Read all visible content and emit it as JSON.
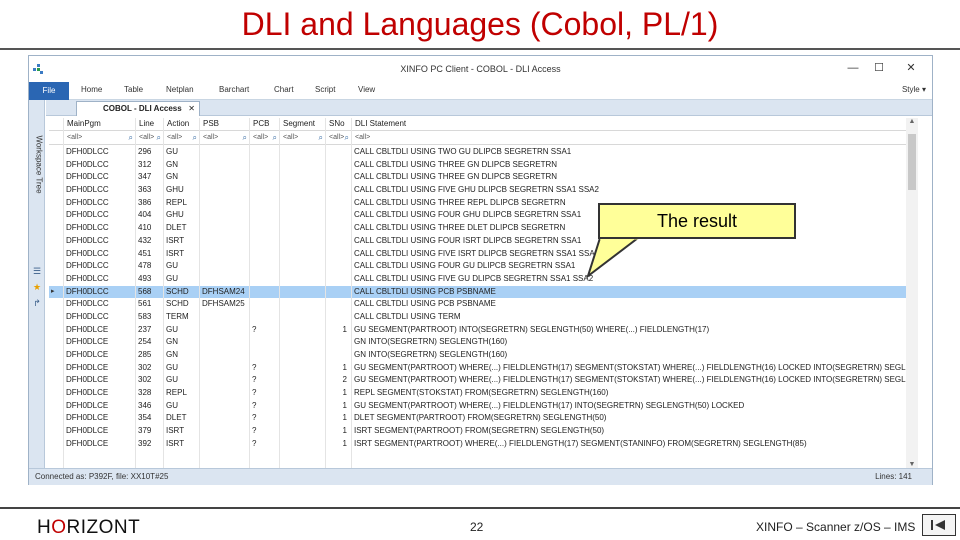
{
  "slide": {
    "title": "DLI and Languages (Cobol, PL/1)",
    "callout": "The result",
    "footer": {
      "brand_prefix": "H",
      "brand_o": "O",
      "brand_suffix": "RIZONT",
      "page_number": "22",
      "text": "XINFO – Scanner z/OS – IMS"
    }
  },
  "window": {
    "title": "XINFO PC Client - COBOL - DLI Access",
    "min": "—",
    "max": "☐",
    "close": "✕"
  },
  "ribbon": {
    "tabs": [
      "File",
      "Home",
      "Table",
      "Netplan",
      "Barchart",
      "Chart",
      "Script",
      "View"
    ],
    "style_menu": "Style"
  },
  "sidebar": {
    "workspace_tree": "Workspace Tree"
  },
  "doc_tab": {
    "label": "COBOL - DLI Access",
    "close": "✕"
  },
  "grid": {
    "columns": [
      "MainPgm",
      "Line",
      "Action",
      "PSB",
      "PCB",
      "Segment",
      "SNo",
      "DLI Statement"
    ],
    "filter_placeholder": "<all>",
    "rows": [
      [
        "DFH0DLCC",
        "296",
        "GU",
        "",
        "",
        "",
        "",
        "CALL CBLTDLI USING TWO GU DLIPCB SEGRETRN SSA1",
        false
      ],
      [
        "DFH0DLCC",
        "312",
        "GN",
        "",
        "",
        "",
        "",
        "CALL CBLTDLI USING THREE GN DLIPCB SEGRETRN",
        false
      ],
      [
        "DFH0DLCC",
        "347",
        "GN",
        "",
        "",
        "",
        "",
        "CALL CBLTDLI USING THREE GN DLIPCB SEGRETRN",
        false
      ],
      [
        "DFH0DLCC",
        "363",
        "GHU",
        "",
        "",
        "",
        "",
        "CALL CBLTDLI USING FIVE GHU DLIPCB SEGRETRN SSA1 SSA2",
        false
      ],
      [
        "DFH0DLCC",
        "386",
        "REPL",
        "",
        "",
        "",
        "",
        "CALL CBLTDLI USING THREE REPL DLIPCB SEGRETRN",
        false
      ],
      [
        "DFH0DLCC",
        "404",
        "GHU",
        "",
        "",
        "",
        "",
        "CALL CBLTDLI USING FOUR GHU DLIPCB SEGRETRN SSA1",
        false
      ],
      [
        "DFH0DLCC",
        "410",
        "DLET",
        "",
        "",
        "",
        "",
        "CALL CBLTDLI USING THREE DLET DLIPCB SEGRETRN",
        false
      ],
      [
        "DFH0DLCC",
        "432",
        "ISRT",
        "",
        "",
        "",
        "",
        "CALL CBLTDLI USING FOUR ISRT DLIPCB SEGRETRN SSA1",
        false
      ],
      [
        "DFH0DLCC",
        "451",
        "ISRT",
        "",
        "",
        "",
        "",
        "CALL CBLTDLI USING FIVE ISRT DLIPCB SEGRETRN SSA1 SSA2",
        false
      ],
      [
        "DFH0DLCC",
        "478",
        "GU",
        "",
        "",
        "",
        "",
        "CALL CBLTDLI USING FOUR GU DLIPCB SEGRETRN SSA1",
        false
      ],
      [
        "DFH0DLCC",
        "493",
        "GU",
        "",
        "",
        "",
        "",
        "CALL CBLTDLI USING FIVE GU DLIPCB SEGRETRN SSA1 SSA2",
        false
      ],
      [
        "DFH0DLCC",
        "568",
        "SCHD",
        "DFHSAM24",
        "",
        "",
        "",
        "CALL CBLTDLI USING PCB PSBNAME",
        true
      ],
      [
        "DFH0DLCC",
        "561",
        "SCHD",
        "DFHSAM25",
        "",
        "",
        "",
        "CALL CBLTDLI USING PCB PSBNAME",
        false
      ],
      [
        "DFH0DLCC",
        "583",
        "TERM",
        "",
        "",
        "",
        "",
        "CALL CBLTDLI USING TERM",
        false
      ],
      [
        "DFH0DLCE",
        "237",
        "GU",
        "",
        "?",
        "",
        "1",
        "GU SEGMENT(PARTROOT) INTO(SEGRETRN) SEGLENGTH(50) WHERE(...) FIELDLENGTH(17)",
        false
      ],
      [
        "DFH0DLCE",
        "254",
        "GN",
        "",
        "",
        "",
        "",
        "GN INTO(SEGRETRN) SEGLENGTH(160)",
        false
      ],
      [
        "DFH0DLCE",
        "285",
        "GN",
        "",
        "",
        "",
        "",
        "GN INTO(SEGRETRN) SEGLENGTH(160)",
        false
      ],
      [
        "DFH0DLCE",
        "302",
        "GU",
        "",
        "?",
        "",
        "1",
        "GU SEGMENT(PARTROOT) WHERE(...) FIELDLENGTH(17) SEGMENT(STOKSTAT) WHERE(...) FIELDLENGTH(16) LOCKED INTO(SEGRETRN) SEGLENGTH(",
        false
      ],
      [
        "DFH0DLCE",
        "302",
        "GU",
        "",
        "?",
        "",
        "2",
        "GU SEGMENT(PARTROOT) WHERE(...) FIELDLENGTH(17) SEGMENT(STOKSTAT) WHERE(...) FIELDLENGTH(16) LOCKED INTO(SEGRETRN) SEGLENGTH(",
        false
      ],
      [
        "DFH0DLCE",
        "328",
        "REPL",
        "",
        "?",
        "",
        "1",
        "REPL SEGMENT(STOKSTAT) FROM(SEGRETRN) SEGLENGTH(160)",
        false
      ],
      [
        "DFH0DLCE",
        "346",
        "GU",
        "",
        "?",
        "",
        "1",
        "GU SEGMENT(PARTROOT) WHERE(...) FIELDLENGTH(17) INTO(SEGRETRN) SEGLENGTH(50) LOCKED",
        false
      ],
      [
        "DFH0DLCE",
        "354",
        "DLET",
        "",
        "?",
        "",
        "1",
        "DLET SEGMENT(PARTROOT) FROM(SEGRETRN) SEGLENGTH(50)",
        false
      ],
      [
        "DFH0DLCE",
        "379",
        "ISRT",
        "",
        "?",
        "",
        "1",
        "ISRT SEGMENT(PARTROOT) FROM(SEGRETRN) SEGLENGTH(50)",
        false
      ],
      [
        "DFH0DLCE",
        "392",
        "ISRT",
        "",
        "?",
        "",
        "1",
        "ISRT SEGMENT(PARTROOT) WHERE(...) FIELDLENGTH(17) SEGMENT(STANINFO) FROM(SEGRETRN) SEGLENGTH(85)",
        false
      ]
    ]
  },
  "status": {
    "left": "Connected as: P392F, file: XX10T#25",
    "right": "Lines: 141"
  },
  "colors": {
    "title_red": "#c00000",
    "ribbon_blue": "#2a66b3",
    "selection": "#a9d0f5",
    "callout_fill": "#ffff99"
  }
}
